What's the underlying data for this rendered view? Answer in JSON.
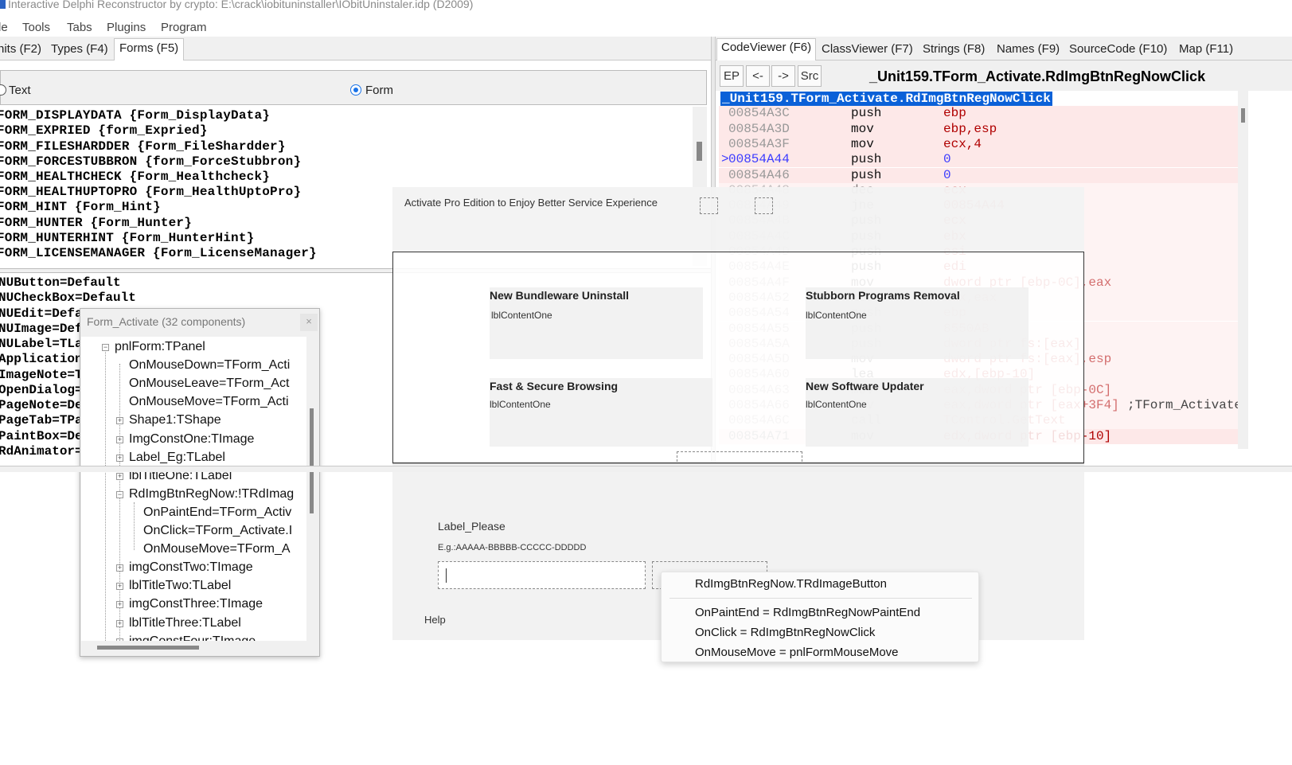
{
  "window": {
    "title": "Interactive Delphi Reconstructor by crypto: E:\\crack\\iobituninstaller\\IObitUninstaler.idp (D2009)"
  },
  "menu": [
    "le",
    "Tools",
    "Tabs",
    "Plugins",
    "Program"
  ],
  "left_tabs": [
    {
      "label": "nits (F2)",
      "active": false
    },
    {
      "label": "Types (F4)",
      "active": false
    },
    {
      "label": "Forms (F5)",
      "active": true
    }
  ],
  "radio": {
    "text_label": "Text",
    "form_label": "Form",
    "selected": "Form"
  },
  "forms_list": [
    "FORM_DISPLAYDATA {Form_DisplayData}",
    "FORM_EXPRIED {form_Expried}",
    "FORM_FILESHARDDER {Form_FileShardder}",
    "FORM_FORCESTUBBRON {form_ForceStubbron}",
    "FORM_HEALTHCHECK {Form_Healthcheck}",
    "FORM_HEALTHUPTOPRO {Form_HealthUptoPro}",
    "FORM_HINT {Form_Hint}",
    "FORM_HUNTER {Form_Hunter}",
    "FORM_HUNTERHINT {Form_HunterHint}",
    "FORM_LICENSEMANAGER {Form_LicenseManager}"
  ],
  "props_list": [
    "NUButton=Default",
    "NUCheckBox=Default",
    "NUEdit=Defa",
    "NUImage=Def",
    "NULabel=TLa",
    "Application",
    "ImageNote=T",
    "OpenDialog=",
    "PageNote=De",
    "PageTab=TPa",
    "PaintBox=De",
    "RdAnimator="
  ],
  "right_tabs": [
    {
      "label": "CodeViewer (F6)",
      "active": true
    },
    {
      "label": "ClassViewer (F7)",
      "active": false
    },
    {
      "label": "Strings (F8)",
      "active": false
    },
    {
      "label": "Names (F9)",
      "active": false
    },
    {
      "label": "SourceCode (F10)",
      "active": false
    },
    {
      "label": "Map (F11)",
      "active": false
    }
  ],
  "code_toolbar": {
    "ep": "EP",
    "back": "<-",
    "forward": "->",
    "src": "Src",
    "title": "_Unit159.TForm_Activate.RdImgBtnRegNowClick"
  },
  "code_label": "_Unit159.TForm_Activate.RdImgBtnRegNowClick",
  "code": [
    {
      "addr": "00854A3C",
      "mn": "push",
      "op": "ebp",
      "extra": "",
      "current": false
    },
    {
      "addr": "00854A3D",
      "mn": "mov",
      "op": "ebp,esp",
      "extra": "",
      "current": false
    },
    {
      "addr": "00854A3F",
      "mn": "mov",
      "op": "ecx,4",
      "extra": "",
      "current": false
    },
    {
      "addr": "00854A44",
      "mn": "push",
      "op": "0",
      "extra": "",
      "current": true
    },
    {
      "addr": "00854A46",
      "mn": "push",
      "op": "0",
      "extra": "",
      "current": false
    },
    {
      "addr": "00854A48",
      "mn": "dec",
      "op": "ecx",
      "extra": "",
      "current": false
    },
    {
      "addr": "00854A49",
      "mn": "jne",
      "op": "00854A44",
      "extra": "",
      "current": false
    },
    {
      "addr": "00854A4B",
      "mn": "push",
      "op": "ecx",
      "extra": "",
      "current": false
    },
    {
      "addr": "00854A4C",
      "mn": "push",
      "op": "ebx",
      "extra": "",
      "current": false
    },
    {
      "addr": "00854A4D",
      "mn": "push",
      "op": "esi",
      "extra": "",
      "current": false
    },
    {
      "addr": "00854A4E",
      "mn": "push",
      "op": "edi",
      "extra": "",
      "current": false
    },
    {
      "addr": "00854A4F",
      "mn": "mov",
      "op": "dword ptr [ebp-0C],eax",
      "extra": "",
      "current": false
    },
    {
      "addr": "00854A52",
      "mn": "xor",
      "op": "eax,eax",
      "extra": "",
      "current": false
    },
    {
      "addr": "00854A54",
      "mn": "push",
      "op": "ebp",
      "extra": "",
      "current": false
    },
    {
      "addr": "00854A55",
      "mn": "push",
      "op": "8550AB",
      "extra": "",
      "current": false
    },
    {
      "addr": "00854A5A",
      "mn": "push",
      "op": "dword ptr fs:[eax]",
      "extra": "",
      "current": false
    },
    {
      "addr": "00854A5D",
      "mn": "mov",
      "op": "dword ptr fs:[eax],esp",
      "extra": "",
      "current": false
    },
    {
      "addr": "00854A60",
      "mn": "lea",
      "op": "edx,[ebp-10]",
      "extra": "",
      "current": false
    },
    {
      "addr": "00854A63",
      "mn": "mov",
      "op": "eax,dword ptr [ebp-0C]",
      "extra": "",
      "current": false
    },
    {
      "addr": "00854A66",
      "mn": "mov",
      "op": "eax,dword ptr [eax+3F4]",
      "extra": ";TForm_Activate",
      "current": false
    },
    {
      "addr": "00854A6C",
      "mn": "call",
      "op": "TControl.GetText",
      "extra": "",
      "current": false
    },
    {
      "addr": "00854A71",
      "mn": "mov",
      "op": "edx,dword ptr [ebp-10]",
      "extra": "",
      "current": false
    }
  ],
  "designer": {
    "header": "Activate Pro Edition to Enjoy Better Service Experience",
    "cards": [
      {
        "title": "New Bundleware Uninstall",
        "sub": "lblContentOne"
      },
      {
        "title": "Stubborn Programs Removal",
        "sub": "lblContentOne"
      },
      {
        "title": "Fast & Secure Browsing",
        "sub": "lblContentOne"
      },
      {
        "title": "New Software Updater",
        "sub": "lblContentOne"
      }
    ],
    "label_please": "Label_Please",
    "example": "E.g.:AAAAA-BBBBB-CCCCC-DDDDD",
    "help": "Help"
  },
  "components": {
    "caption": "Form_Activate (32 components)",
    "close": "×",
    "nodes": [
      {
        "label": "pnlForm:TPanel",
        "level": 0,
        "box": "−"
      },
      {
        "label": "OnMouseDown=TForm_Acti",
        "level": 1,
        "box": ""
      },
      {
        "label": "OnMouseLeave=TForm_Act",
        "level": 1,
        "box": ""
      },
      {
        "label": "OnMouseMove=TForm_Acti",
        "level": 1,
        "box": ""
      },
      {
        "label": "Shape1:TShape",
        "level": 1,
        "box": "+"
      },
      {
        "label": "ImgConstOne:TImage",
        "level": 1,
        "box": "+"
      },
      {
        "label": "Label_Eg:TLabel",
        "level": 1,
        "box": "+"
      },
      {
        "label": "lblTitleOne:TLabel",
        "level": 1,
        "box": "+"
      },
      {
        "label": "RdImgBtnRegNow:!TRdImag",
        "level": 1,
        "box": "−"
      },
      {
        "label": "OnPaintEnd=TForm_Activ",
        "level": 2,
        "box": ""
      },
      {
        "label": "OnClick=TForm_Activate.I",
        "level": 2,
        "box": ""
      },
      {
        "label": "OnMouseMove=TForm_A",
        "level": 2,
        "box": ""
      },
      {
        "label": "imgConstTwo:TImage",
        "level": 1,
        "box": "+"
      },
      {
        "label": "lblTitleTwo:TLabel",
        "level": 1,
        "box": "+"
      },
      {
        "label": "imgConstThree:TImage",
        "level": 1,
        "box": "+"
      },
      {
        "label": "lblTitleThree:TLabel",
        "level": 1,
        "box": "+"
      },
      {
        "label": "imgConstFour:TImage",
        "level": 1,
        "box": "+"
      }
    ]
  },
  "context_menu": {
    "header": "RdImgBtnRegNow.TRdImageButton",
    "items": [
      "OnPaintEnd = RdImgBtnRegNowPaintEnd",
      "OnClick = RdImgBtnRegNowClick",
      "OnMouseMove = pnlFormMouseMove"
    ]
  },
  "colors": {
    "selection": "#0b61d8",
    "register": "#b00000",
    "number": "#3c3cff",
    "pink_row": "#fde8e8"
  }
}
